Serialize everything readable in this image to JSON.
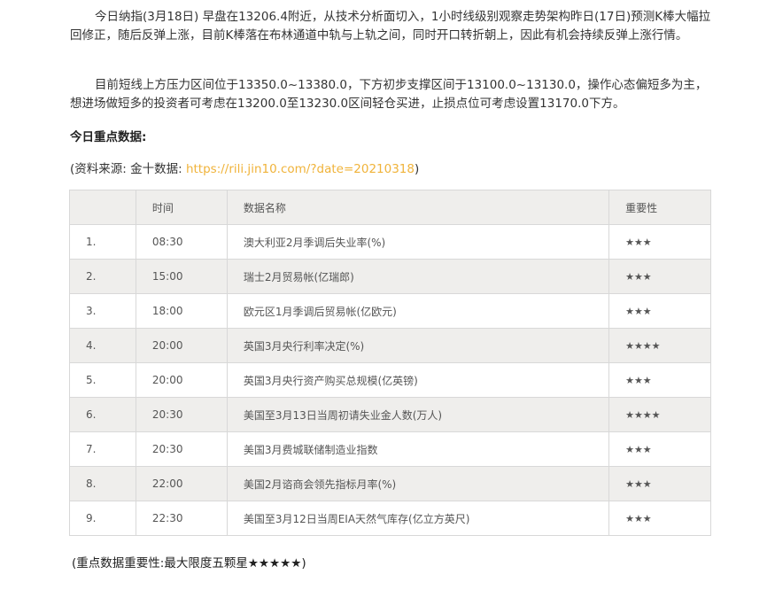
{
  "article": {
    "paragraph1": "今日纳指(3月18日) 早盘在13206.4附近，从技术分析面切入，1小时线级别观察走势架构昨日(17日)预测K棒大幅拉回修正，随后反弹上涨，目前K棒落在布林通道中轨与上轨之间，同时开口转折朝上，因此有机会持续反弹上涨行情。",
    "paragraph2": "目前短线上方压力区间位于13350.0~13380.0，下方初步支撑区间于13100.0~13130.0，操作心态偏短多为主，想进场做短多的投资者可考虑在13200.0至13230.0区间轻仓买进，止损点位可考虑设置13170.0下方。",
    "heading": "今日重点数据:",
    "source_prefix": "(资料来源: 金十数据: ",
    "source_link": "https://rili.jin10.com/?date=20210318",
    "source_suffix": ")",
    "footnote": "(重点数据重要性:最大限度五颗星★★★★★)"
  },
  "table": {
    "headers": [
      "",
      "时间",
      "数据名称",
      "重要性"
    ],
    "rows": [
      {
        "no": "1.",
        "time": "08:30",
        "name": "澳大利亚2月季调后失业率(%)",
        "importance": "★★★"
      },
      {
        "no": "2.",
        "time": "15:00",
        "name": "瑞士2月贸易帐(亿瑞郎)",
        "importance": "★★★"
      },
      {
        "no": "3.",
        "time": "18:00",
        "name": "欧元区1月季调后贸易帐(亿欧元)",
        "importance": "★★★"
      },
      {
        "no": "4.",
        "time": "20:00",
        "name": "英国3月央行利率决定(%)",
        "importance": "★★★★"
      },
      {
        "no": "5.",
        "time": "20:00",
        "name": "英国3月央行资产购买总规模(亿英镑)",
        "importance": "★★★"
      },
      {
        "no": "6.",
        "time": "20:30",
        "name": "美国至3月13日当周初请失业金人数(万人)",
        "importance": "★★★★"
      },
      {
        "no": "7.",
        "time": "20:30",
        "name": "美国3月费城联储制造业指数",
        "importance": "★★★"
      },
      {
        "no": "8.",
        "time": "22:00",
        "name": "美国2月谘商会领先指标月率(%)",
        "importance": "★★★"
      },
      {
        "no": "9.",
        "time": "22:30",
        "name": "美国至3月12日当周EIA天然气库存(亿立方英尺)",
        "importance": "★★★"
      }
    ]
  },
  "colors": {
    "link": "#f0b33a",
    "stripe": "#efeeec",
    "border": "#d8d8d8"
  }
}
